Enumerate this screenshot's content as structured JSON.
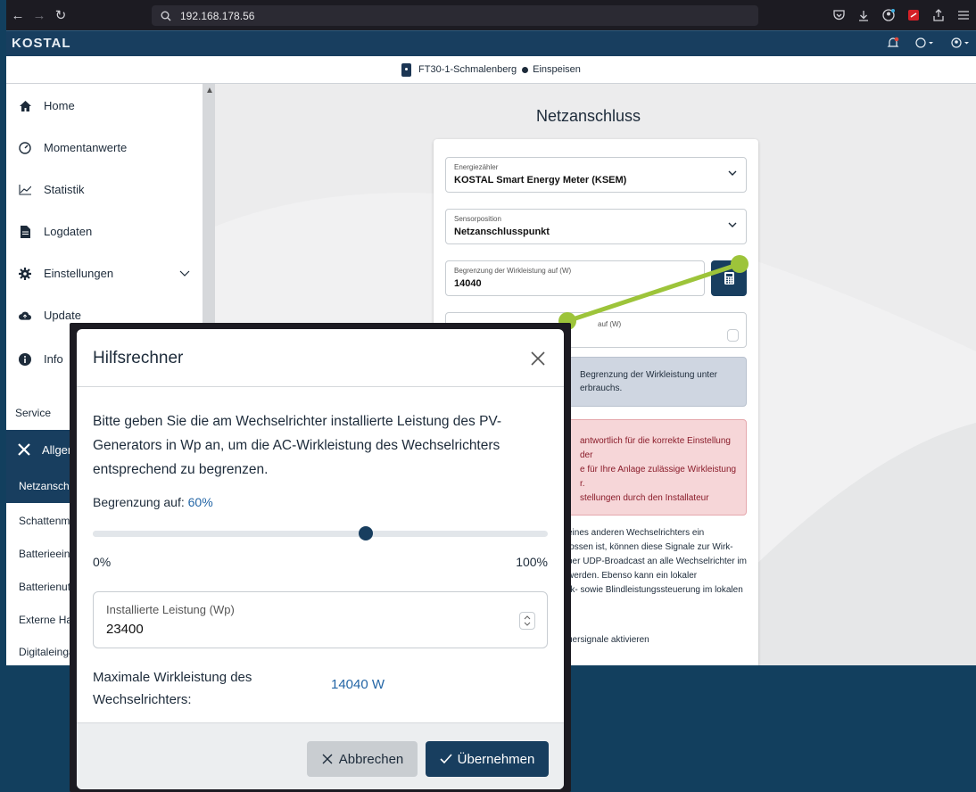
{
  "browser": {
    "url": "192.168.178.56"
  },
  "app": {
    "logo": "KOSTAL"
  },
  "status": {
    "device": "FT30-1-Schmalenberg",
    "mode": "Einspeisen"
  },
  "sidebar": {
    "items": [
      {
        "label": "Home",
        "icon": "home-icon"
      },
      {
        "label": "Momentanwerte",
        "icon": "speedometer-icon"
      },
      {
        "label": "Statistik",
        "icon": "chart-line-icon"
      },
      {
        "label": "Logdaten",
        "icon": "document-icon"
      },
      {
        "label": "Einstellungen",
        "icon": "gear-icon"
      },
      {
        "label": "Update",
        "icon": "cloud-upload-icon"
      },
      {
        "label": "Info",
        "icon": "info-icon"
      }
    ],
    "section_label": "Service",
    "group_label": "Allgem",
    "subitems": [
      "Netzanschlu",
      "Schattenma",
      "Batterieeins",
      "Batterienutz",
      "Externe Har",
      "Digitaleingä"
    ]
  },
  "page": {
    "title": "Netzanschluss"
  },
  "form": {
    "meter_label": "Energiezähler",
    "meter_value": "KOSTAL Smart Energy Meter (KSEM)",
    "sensor_label": "Sensorposition",
    "sensor_value": "Netzanschlusspunkt",
    "limit_label": "Begrenzung der Wirkleistung auf (W)",
    "limit_value": "14040",
    "second_label": "auf (W)",
    "info_line1": "Begrenzung der Wirkleistung unter",
    "info_line2": "erbrauchs.",
    "warn_line1": "antwortlich für die korrekte Einstellung der",
    "warn_line2": "e für Ihre Anlage zulässige Wirkleistung",
    "warn_line3": "r.",
    "warn_line4": "stellungen durch den Installateur",
    "body_line1": "eines anderen Wechselrichters ein",
    "body_line2": "lossen ist, können diese Signale zur Wirk-",
    "body_line3": "per UDP-Broadcast an alle Wechselrichter im",
    "body_line4": "werden. Ebenso kann ein lokaler",
    "body_line5": "rk- sowie Blindleistungssteuerung im lokalen",
    "body_line6": "uersignale aktivieren"
  },
  "modal": {
    "title": "Hilfsrechner",
    "description": "Bitte geben Sie die am Wechselrichter installierte Leistung des PV-Generators in Wp an, um die AC-Wirkleistung des Wechselrichters entsprechend zu begrenzen.",
    "limit_label": "Begrenzung auf:",
    "limit_value": "60%",
    "slider_percent": 60,
    "slider_min": "0%",
    "slider_max": "100%",
    "input_label": "Installierte Leistung (Wp)",
    "input_value": "23400",
    "max_label": "Maximale Wirkleistung des Wechselrichters:",
    "max_value": "14040 W",
    "cancel_label": "Abbrechen",
    "ok_label": "Übernehmen"
  },
  "colors": {
    "brand": "#183e5f",
    "accent_link": "#2466a6",
    "pointer": "#9dc43a",
    "background": "#123f5e"
  }
}
